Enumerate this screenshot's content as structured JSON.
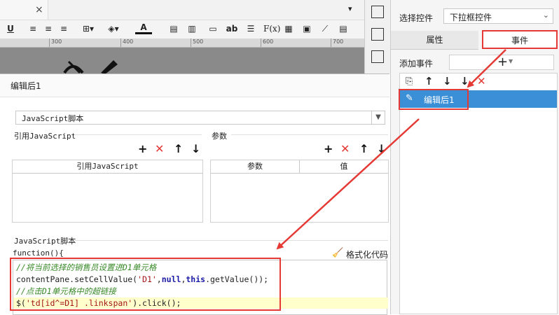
{
  "editor": {
    "tab_close": "×",
    "toolbar": {
      "underline": "U",
      "ab_label": "ab",
      "fx_label": "F(x)",
      "font_color_label": "A"
    },
    "ruler_marks": [
      "300",
      "400",
      "500",
      "600",
      "700"
    ]
  },
  "dialog": {
    "title": "编辑后1",
    "script_type": "JavaScript脚本",
    "ref_js_section": "引用JavaScript",
    "params_section": "参数",
    "ref_js_column": "引用JavaScript",
    "params_column_param": "参数",
    "params_column_value": "值",
    "script_section": "JavaScript脚本",
    "function_header": "function(){",
    "format_code": "格式化代码",
    "code": {
      "line1": "//将当前选择的销售员设置进D1单元格",
      "line2_a": "contentPane.setCellValue(",
      "line2_b": "'D1'",
      "line2_c": ",",
      "line2_d": "null",
      "line2_e": ",",
      "line2_f": "this",
      "line2_g": ".getValue());",
      "line3": "//点击D1单元格中的超链接",
      "line4_a": "$(",
      "line4_b": "'td[id^=D1] .linkspan'",
      "line4_c": ").click();"
    }
  },
  "right_panel": {
    "select_label": "选择控件",
    "control_type": "下拉框控件",
    "tab_properties": "属性",
    "tab_events": "事件",
    "add_event": "添加事件",
    "event_name": "编辑后1"
  },
  "colors": {
    "highlight_red": "#e53935",
    "selection_blue": "#3a8fd6",
    "comment_green": "#3a8a2a",
    "keyword_blue": "#1a1aa6",
    "string_red": "#a31515",
    "line_highlight": "#ffffcc"
  },
  "icons": [
    "close-icon",
    "plus-icon",
    "delete-icon",
    "arrow-up-icon",
    "arrow-down-icon",
    "edit-icon",
    "broom-icon",
    "chevron-down-icon",
    "copy-icon"
  ]
}
